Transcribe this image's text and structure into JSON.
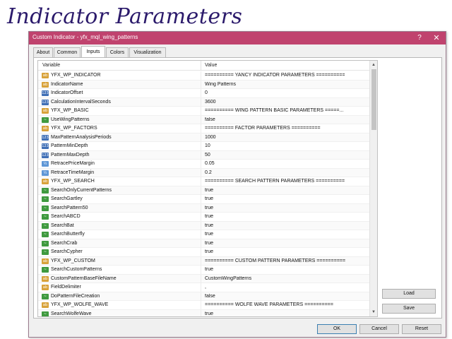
{
  "page_heading": "Indicator Parameters",
  "dialog": {
    "title": "Custom Indicator - yfx_mql_wing_patterns",
    "help_glyph": "?",
    "close_glyph": "✕",
    "titlebar_color": "#c0436e"
  },
  "tabs": [
    {
      "label": "About",
      "active": false
    },
    {
      "label": "Common",
      "active": false
    },
    {
      "label": "Inputs",
      "active": true
    },
    {
      "label": "Colors",
      "active": false
    },
    {
      "label": "Visualization",
      "active": false
    }
  ],
  "grid": {
    "col_variable": "Variable",
    "col_value": "Value",
    "rows": [
      {
        "icon": "ab",
        "icon_text": "ab",
        "variable": "YFX_WP_INDICATOR",
        "value": "========== YANCY INDICATOR PARAMETERS =========="
      },
      {
        "icon": "ab",
        "icon_text": "ab",
        "variable": "IndicatorName",
        "value": "Wing Patterns"
      },
      {
        "icon": "num",
        "icon_text": "123",
        "variable": "IndicatorOffset",
        "value": "0"
      },
      {
        "icon": "num",
        "icon_text": "123",
        "variable": "CalculationIntervalSeconds",
        "value": "3600"
      },
      {
        "icon": "ab",
        "icon_text": "ab",
        "variable": "YFX_WP_BASIC",
        "value": "========== WING PATTERN BASIC PARAMETERS =====..."
      },
      {
        "icon": "bool",
        "icon_text": "~",
        "variable": "UseWingPatterns",
        "value": "false"
      },
      {
        "icon": "ab",
        "icon_text": "ab",
        "variable": "YFX_WP_FACTORS",
        "value": "========== FACTOR PARAMETERS =========="
      },
      {
        "icon": "num",
        "icon_text": "123",
        "variable": "MaxPatternAnalysisPeriods",
        "value": "1000"
      },
      {
        "icon": "num",
        "icon_text": "123",
        "variable": "PatternMinDepth",
        "value": "10"
      },
      {
        "icon": "num",
        "icon_text": "123",
        "variable": "PatternMaxDepth",
        "value": "50"
      },
      {
        "icon": "dbl",
        "icon_text": "½",
        "variable": "RetracePriceMargin",
        "value": "0.05"
      },
      {
        "icon": "dbl",
        "icon_text": "½",
        "variable": "RetraceTimeMargin",
        "value": "0.2"
      },
      {
        "icon": "ab",
        "icon_text": "ab",
        "variable": "YFX_WP_SEARCH",
        "value": "========== SEARCH PATTERN PARAMETERS =========="
      },
      {
        "icon": "bool",
        "icon_text": "~",
        "variable": "SearchOnlyCurrentPatterns",
        "value": "true"
      },
      {
        "icon": "bool",
        "icon_text": "~",
        "variable": "SearchGartley",
        "value": "true"
      },
      {
        "icon": "bool",
        "icon_text": "~",
        "variable": "SearchPattern50",
        "value": "true"
      },
      {
        "icon": "bool",
        "icon_text": "~",
        "variable": "SearchABCD",
        "value": "true"
      },
      {
        "icon": "bool",
        "icon_text": "~",
        "variable": "SearchBat",
        "value": "true"
      },
      {
        "icon": "bool",
        "icon_text": "~",
        "variable": "SearchButterfly",
        "value": "true"
      },
      {
        "icon": "bool",
        "icon_text": "~",
        "variable": "SearchCrab",
        "value": "true"
      },
      {
        "icon": "bool",
        "icon_text": "~",
        "variable": "SearchCypher",
        "value": "true"
      },
      {
        "icon": "ab",
        "icon_text": "ab",
        "variable": "YFX_WP_CUSTOM",
        "value": "========== CUSTOM PATTERN PARAMETERS =========="
      },
      {
        "icon": "bool",
        "icon_text": "~",
        "variable": "SearchCustomPatterns",
        "value": "true"
      },
      {
        "icon": "ab",
        "icon_text": "ab",
        "variable": "CustomPatternBaseFileName",
        "value": "CustomWingPatterns"
      },
      {
        "icon": "ab",
        "icon_text": "ab",
        "variable": "FieldDelimiter",
        "value": ","
      },
      {
        "icon": "bool",
        "icon_text": "~",
        "variable": "DoPatternFileCreation",
        "value": "false"
      },
      {
        "icon": "ab",
        "icon_text": "ab",
        "variable": "YFX_WP_WOLFE_WAVE",
        "value": "========== WOLFE WAVE PARAMETERS =========="
      },
      {
        "icon": "bool",
        "icon_text": "~",
        "variable": "SearchWolfeWave",
        "value": "true"
      }
    ],
    "scroll_up_glyph": "▲",
    "scroll_down_glyph": "▼"
  },
  "buttons": {
    "load": "Load",
    "save": "Save",
    "ok": "OK",
    "cancel": "Cancel",
    "reset": "Reset"
  }
}
